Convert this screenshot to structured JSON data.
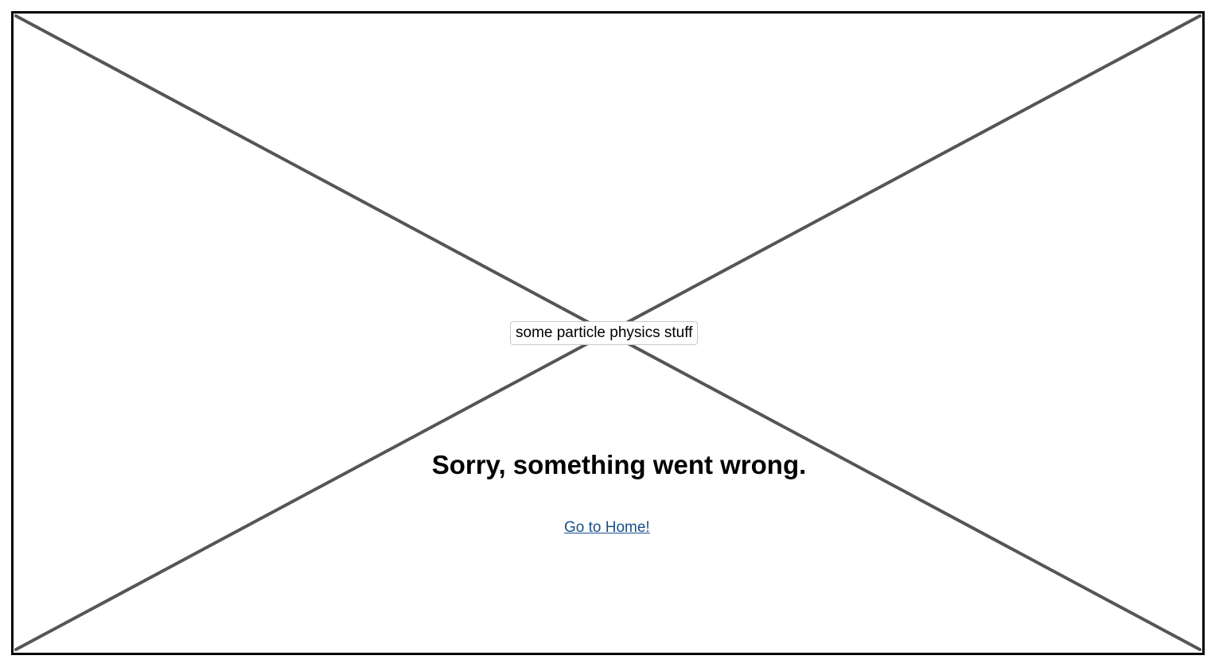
{
  "image_placeholder": {
    "label": "some particle physics stuff"
  },
  "error": {
    "title": "Sorry, something went wrong.",
    "home_link": "Go to Home!"
  },
  "colors": {
    "frame": "#000000",
    "placeholder_lines": "#555555",
    "link": "#1a4e8a"
  }
}
